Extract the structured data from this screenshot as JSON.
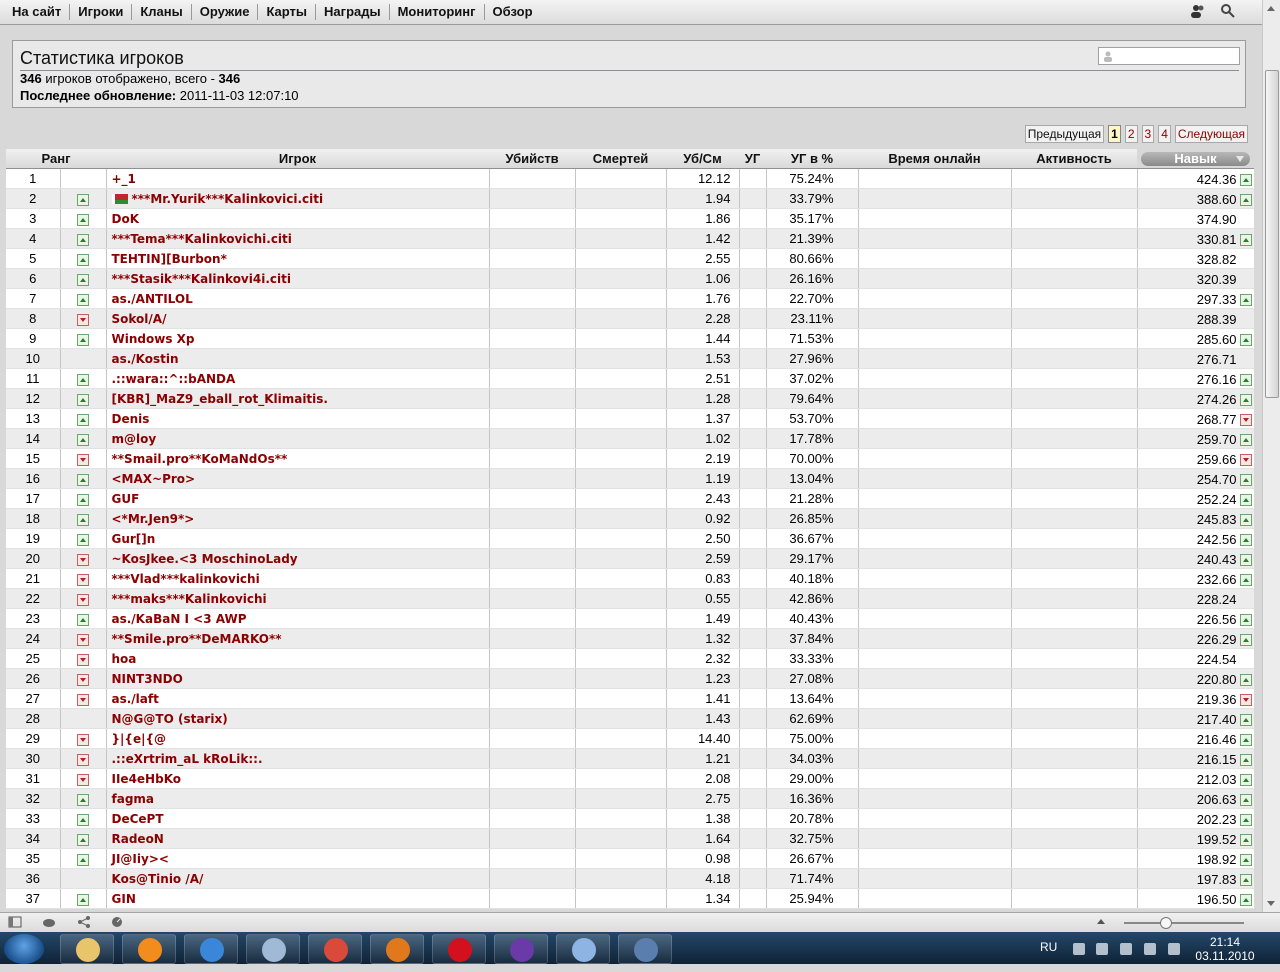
{
  "nav": {
    "items": [
      "На сайт",
      "Игроки",
      "Кланы",
      "Оружие",
      "Карты",
      "Награды",
      "Мониторинг",
      "Обзор"
    ]
  },
  "header": {
    "title": "Статистика игроков",
    "shown_count": "346",
    "shown_text": " игроков отображено, всего - ",
    "total_count": "346",
    "updated_label": "Последнее обновление:",
    "updated_value": " 2011-11-03 12:07:10",
    "search_placeholder": ""
  },
  "pager": {
    "prev": "Предыдущая",
    "pages": [
      "1",
      "2",
      "3",
      "4"
    ],
    "current": "1",
    "next": "Следующая"
  },
  "table": {
    "columns": [
      "Ранг",
      "Игрок",
      "Убийств",
      "Смертей",
      "Уб/См",
      "УГ",
      "УГ в %",
      "Время онлайн",
      "Активность",
      "Навык"
    ],
    "rows": [
      {
        "rank": "1",
        "trend": "",
        "flag": false,
        "name": "+_1",
        "kd": "12.12",
        "hs": "75.24%",
        "skill": "424.36",
        "skill_trend": "up"
      },
      {
        "rank": "2",
        "trend": "up",
        "flag": true,
        "name": "***Mr.Yurik***Kalinkovici.citi",
        "kd": "1.94",
        "hs": "33.79%",
        "skill": "388.60",
        "skill_trend": "up"
      },
      {
        "rank": "3",
        "trend": "up",
        "flag": false,
        "name": "DoK",
        "kd": "1.86",
        "hs": "35.17%",
        "skill": "374.90",
        "skill_trend": ""
      },
      {
        "rank": "4",
        "trend": "up",
        "flag": false,
        "name": "***Tema***Kalinkovichi.citi",
        "kd": "1.42",
        "hs": "21.39%",
        "skill": "330.81",
        "skill_trend": "up"
      },
      {
        "rank": "5",
        "trend": "up",
        "flag": false,
        "name": "TEHTIN][Burbon*",
        "kd": "2.55",
        "hs": "80.66%",
        "skill": "328.82",
        "skill_trend": ""
      },
      {
        "rank": "6",
        "trend": "up",
        "flag": false,
        "name": "***Stasik***Kalinkovi4i.citi",
        "kd": "1.06",
        "hs": "26.16%",
        "skill": "320.39",
        "skill_trend": ""
      },
      {
        "rank": "7",
        "trend": "up",
        "flag": false,
        "name": "as./ANTILOL",
        "kd": "1.76",
        "hs": "22.70%",
        "skill": "297.33",
        "skill_trend": "up"
      },
      {
        "rank": "8",
        "trend": "down",
        "flag": false,
        "name": "Sokol/A/",
        "kd": "2.28",
        "hs": "23.11%",
        "skill": "288.39",
        "skill_trend": ""
      },
      {
        "rank": "9",
        "trend": "up",
        "flag": false,
        "name": "Windows Xp",
        "kd": "1.44",
        "hs": "71.53%",
        "skill": "285.60",
        "skill_trend": "up"
      },
      {
        "rank": "10",
        "trend": "",
        "flag": false,
        "name": "as./Kostin",
        "kd": "1.53",
        "hs": "27.96%",
        "skill": "276.71",
        "skill_trend": ""
      },
      {
        "rank": "11",
        "trend": "up",
        "flag": false,
        "name": ".::wara::^::bANDA",
        "kd": "2.51",
        "hs": "37.02%",
        "skill": "276.16",
        "skill_trend": "up"
      },
      {
        "rank": "12",
        "trend": "up",
        "flag": false,
        "name": "[KBR]_MaZ9_eball_rot_Klimaitis.",
        "kd": "1.28",
        "hs": "79.64%",
        "skill": "274.26",
        "skill_trend": "up"
      },
      {
        "rank": "13",
        "trend": "up",
        "flag": false,
        "name": "Denis",
        "kd": "1.37",
        "hs": "53.70%",
        "skill": "268.77",
        "skill_trend": "down"
      },
      {
        "rank": "14",
        "trend": "up",
        "flag": false,
        "name": "m@loy",
        "kd": "1.02",
        "hs": "17.78%",
        "skill": "259.70",
        "skill_trend": "up"
      },
      {
        "rank": "15",
        "trend": "down",
        "flag": false,
        "name": "**Smail.pro**KoMaNdOs**",
        "kd": "2.19",
        "hs": "70.00%",
        "skill": "259.66",
        "skill_trend": "down"
      },
      {
        "rank": "16",
        "trend": "up",
        "flag": false,
        "name": "<MAX~Pro>",
        "kd": "1.19",
        "hs": "13.04%",
        "skill": "254.70",
        "skill_trend": "up"
      },
      {
        "rank": "17",
        "trend": "up",
        "flag": false,
        "name": "GUF",
        "kd": "2.43",
        "hs": "21.28%",
        "skill": "252.24",
        "skill_trend": "up"
      },
      {
        "rank": "18",
        "trend": "up",
        "flag": false,
        "name": "<*Mr.Jen9*>",
        "kd": "0.92",
        "hs": "26.85%",
        "skill": "245.83",
        "skill_trend": "up"
      },
      {
        "rank": "19",
        "trend": "up",
        "flag": false,
        "name": "Gur[]n",
        "kd": "2.50",
        "hs": "36.67%",
        "skill": "242.56",
        "skill_trend": "up"
      },
      {
        "rank": "20",
        "trend": "down",
        "flag": false,
        "name": "~KosJkee.<3 MoschinoLady",
        "kd": "2.59",
        "hs": "29.17%",
        "skill": "240.43",
        "skill_trend": "up"
      },
      {
        "rank": "21",
        "trend": "down",
        "flag": false,
        "name": "***Vlad***kalinkovichi",
        "kd": "0.83",
        "hs": "40.18%",
        "skill": "232.66",
        "skill_trend": "up"
      },
      {
        "rank": "22",
        "trend": "down",
        "flag": false,
        "name": "***maks***Kalinkovichi",
        "kd": "0.55",
        "hs": "42.86%",
        "skill": "228.24",
        "skill_trend": ""
      },
      {
        "rank": "23",
        "trend": "up",
        "flag": false,
        "name": "as./KaBaN I <3 AWP",
        "kd": "1.49",
        "hs": "40.43%",
        "skill": "226.56",
        "skill_trend": "up"
      },
      {
        "rank": "24",
        "trend": "down",
        "flag": false,
        "name": "**Smile.pro**DeMARKO**",
        "kd": "1.32",
        "hs": "37.84%",
        "skill": "226.29",
        "skill_trend": "up"
      },
      {
        "rank": "25",
        "trend": "down",
        "flag": false,
        "name": "hoa",
        "kd": "2.32",
        "hs": "33.33%",
        "skill": "224.54",
        "skill_trend": ""
      },
      {
        "rank": "26",
        "trend": "down",
        "flag": false,
        "name": "NINT3NDO",
        "kd": "1.23",
        "hs": "27.08%",
        "skill": "220.80",
        "skill_trend": "up"
      },
      {
        "rank": "27",
        "trend": "down",
        "flag": false,
        "name": "as./laft",
        "kd": "1.41",
        "hs": "13.64%",
        "skill": "219.36",
        "skill_trend": "down"
      },
      {
        "rank": "28",
        "trend": "",
        "flag": false,
        "name": "N@G@TO (starix)",
        "kd": "1.43",
        "hs": "62.69%",
        "skill": "217.40",
        "skill_trend": "up"
      },
      {
        "rank": "29",
        "trend": "down",
        "flag": false,
        "name": "}|{e|{@",
        "kd": "14.40",
        "hs": "75.00%",
        "skill": "216.46",
        "skill_trend": "up"
      },
      {
        "rank": "30",
        "trend": "down",
        "flag": false,
        "name": ".::eXrtrim_aL kRoLik::.",
        "kd": "1.21",
        "hs": "34.03%",
        "skill": "216.15",
        "skill_trend": "up"
      },
      {
        "rank": "31",
        "trend": "down",
        "flag": false,
        "name": "IIe4eHbKo",
        "kd": "2.08",
        "hs": "29.00%",
        "skill": "212.03",
        "skill_trend": "up"
      },
      {
        "rank": "32",
        "trend": "up",
        "flag": false,
        "name": "fagma",
        "kd": "2.75",
        "hs": "16.36%",
        "skill": "206.63",
        "skill_trend": "up"
      },
      {
        "rank": "33",
        "trend": "up",
        "flag": false,
        "name": "DeCePT",
        "kd": "1.38",
        "hs": "20.78%",
        "skill": "202.23",
        "skill_trend": "up"
      },
      {
        "rank": "34",
        "trend": "up",
        "flag": false,
        "name": "RadeoN",
        "kd": "1.64",
        "hs": "32.75%",
        "skill": "199.52",
        "skill_trend": "up"
      },
      {
        "rank": "35",
        "trend": "up",
        "flag": false,
        "name": "JI@Iiy><",
        "kd": "0.98",
        "hs": "26.67%",
        "skill": "198.92",
        "skill_trend": "up"
      },
      {
        "rank": "36",
        "trend": "",
        "flag": false,
        "name": "Kos@Tinio /A/",
        "kd": "4.18",
        "hs": "71.74%",
        "skill": "197.83",
        "skill_trend": "up"
      },
      {
        "rank": "37",
        "trend": "up",
        "flag": false,
        "name": "GIN",
        "kd": "1.34",
        "hs": "25.94%",
        "skill": "196.50",
        "skill_trend": "up"
      }
    ]
  },
  "taskbar": {
    "lang": "RU",
    "time": "21:14",
    "date": "03.11.2010"
  },
  "icons": {
    "taskbar_apps": [
      "explorer-icon",
      "media-player-icon",
      "ie-icon",
      "safari-icon",
      "chrome-icon",
      "firefox-icon",
      "opera-icon",
      "torrent-icon",
      "notepad-icon",
      "network-icon"
    ]
  },
  "colors": {
    "player_name": "#8b0000",
    "trend_up": "#2d7b2d",
    "trend_down": "#b12020",
    "sort_pill": "#9a9a9a"
  }
}
